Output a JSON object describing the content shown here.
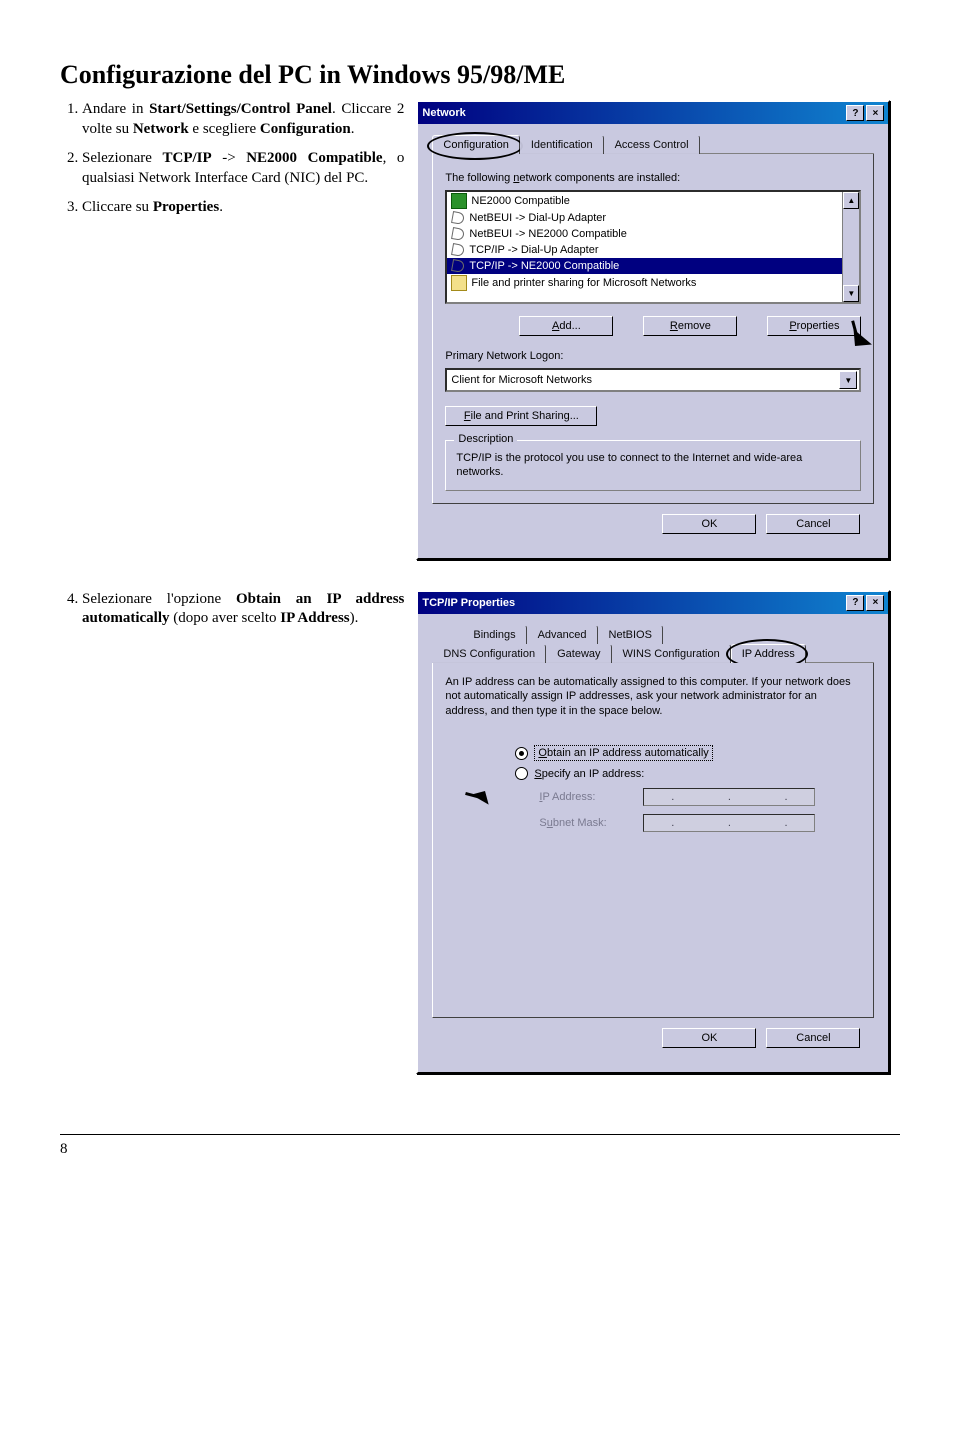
{
  "title": "Configurazione del PC in Windows 95/98/ME",
  "steps_a": {
    "s1_pre": "Andare in ",
    "s1_b": "Start/Settings/Control Panel",
    "s1_post1": ". Cliccare 2 volte su ",
    "s1_b2": "Network",
    "s1_post2": " e scegliere ",
    "s1_b3": "Configuration",
    "s1_post3": ".",
    "s2_pre": "Selezionare ",
    "s2_b1": "TCP/IP",
    "s2_mid": " -> ",
    "s2_b2": "NE2000 Compatible",
    "s2_post": ", o qualsiasi Network Interface Card (NIC) del PC.",
    "s3_pre": "Cliccare su ",
    "s3_b": "Properties",
    "s3_post": "."
  },
  "steps_b": {
    "s4_pre": "Selezionare l'opzione ",
    "s4_b": "Obtain an IP address automatically",
    "s4_post": " (dopo aver scelto ",
    "s4_b2": "IP Address",
    "s4_post2": ")."
  },
  "dlg1": {
    "title": "Network",
    "tabs": [
      "Configuration",
      "Identification",
      "Access Control"
    ],
    "label_installed": "The following network components are installed:",
    "list": [
      "NE2000 Compatible",
      "NetBEUI -> Dial-Up Adapter",
      "NetBEUI -> NE2000 Compatible",
      "TCP/IP -> Dial-Up Adapter",
      "TCP/IP -> NE2000 Compatible",
      "File and printer sharing for Microsoft Networks"
    ],
    "btn_add": "Add...",
    "btn_remove": "Remove",
    "btn_props": "Properties",
    "label_logon": "Primary Network Logon:",
    "logon_value": "Client for Microsoft Networks",
    "btn_fps": "File and Print Sharing...",
    "desc_title": "Description",
    "desc_text": "TCP/IP is the protocol you use to connect to the Internet and wide-area networks.",
    "ok": "OK",
    "cancel": "Cancel"
  },
  "dlg2": {
    "title": "TCP/IP Properties",
    "tabs_top": [
      "Bindings",
      "Advanced",
      "NetBIOS"
    ],
    "tabs_bot": [
      "DNS Configuration",
      "Gateway",
      "WINS Configuration",
      "IP Address"
    ],
    "intro": "An IP address can be automatically assigned to this computer. If your network does not automatically assign IP addresses, ask your network administrator for an address, and then type it in the space below.",
    "opt1": "Obtain an IP address automatically",
    "opt2": "Specify an IP address:",
    "lbl_ip": "IP Address:",
    "lbl_mask": "Subnet Mask:",
    "ok": "OK",
    "cancel": "Cancel"
  },
  "underline": {
    "n": "n",
    "A": "A",
    "R": "R",
    "P": "P",
    "F": "F",
    "O": "O",
    "S": "S",
    "I": "I",
    "u": "u"
  },
  "pagenum": "8"
}
